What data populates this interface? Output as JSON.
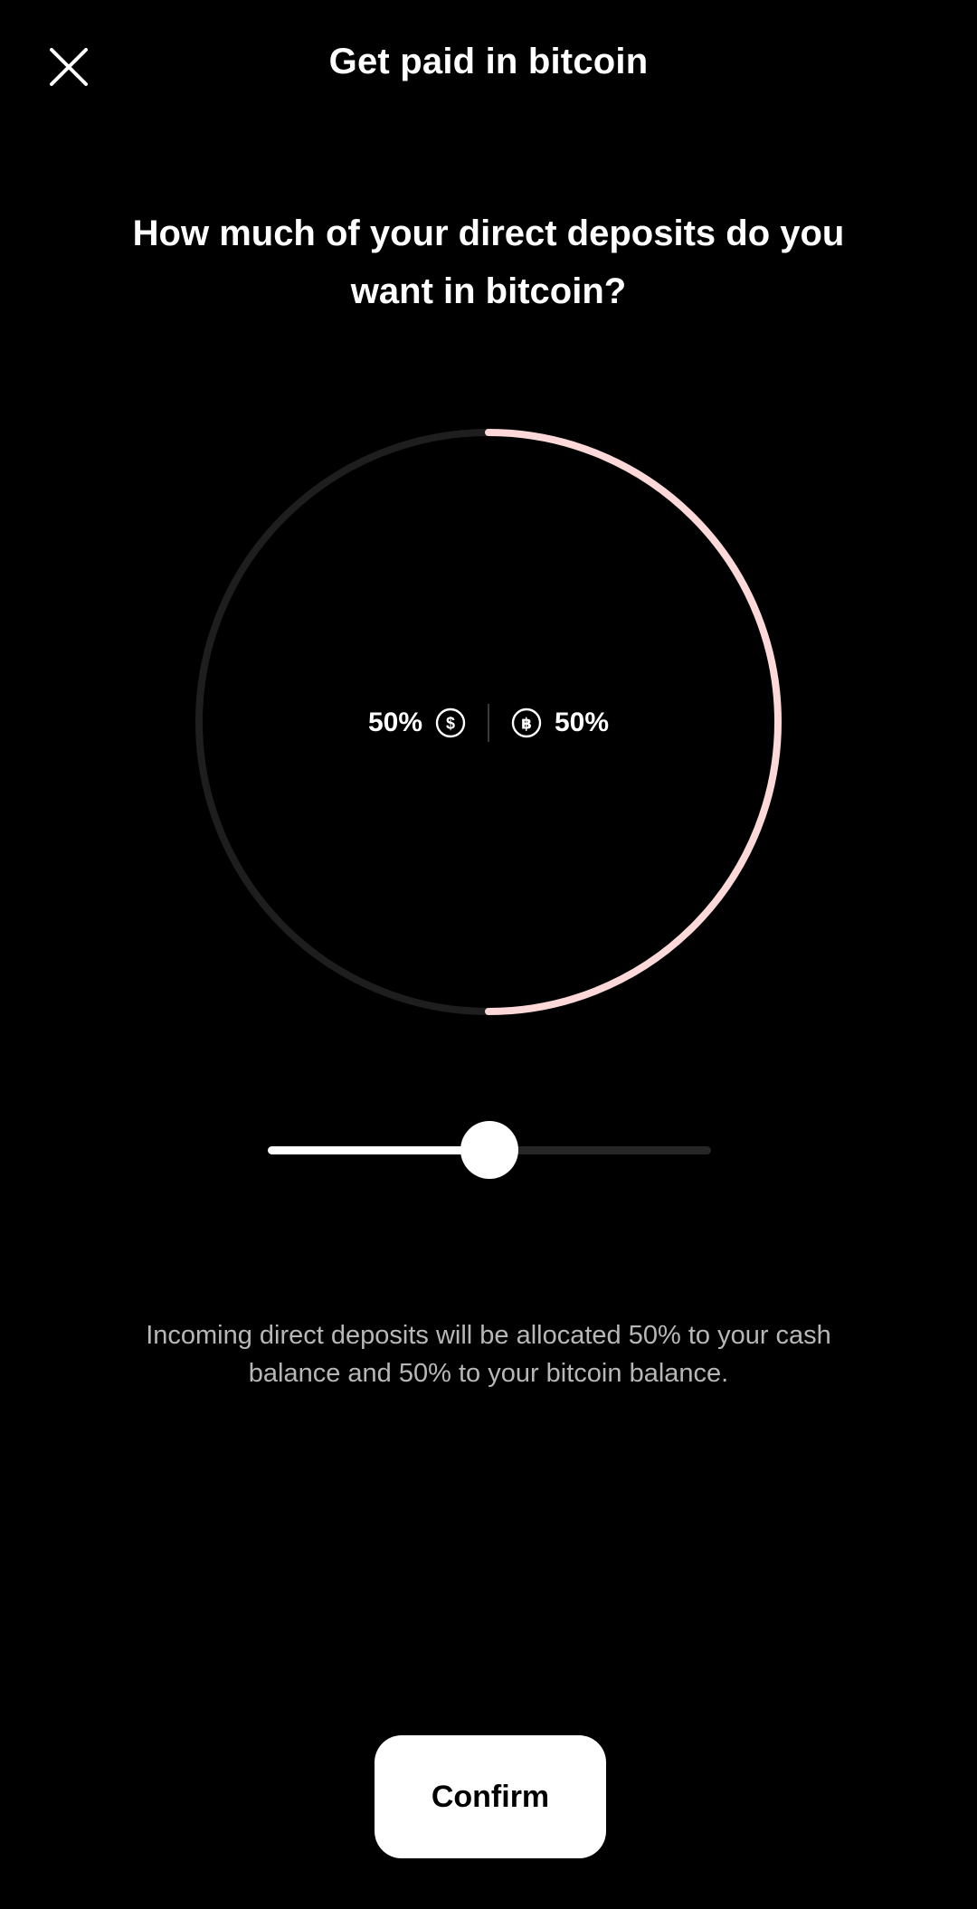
{
  "header": {
    "title": "Get paid in bitcoin",
    "close_icon": "close-icon"
  },
  "question": "How much of your direct deposits do you want in bitcoin?",
  "allocation": {
    "cash_label": "50%",
    "bitcoin_label": "50%",
    "bitcoin_fraction": 0.5,
    "cash_icon": "dollar-coin-icon",
    "bitcoin_icon": "bitcoin-coin-icon",
    "ring_track_color": "#1e1e1e",
    "ring_bitcoin_color": "#fcd8d8"
  },
  "slider": {
    "value_percent": 50
  },
  "description": "Incoming direct deposits will be allocated 50% to your cash balance and 50% to your bitcoin balance.",
  "confirm_label": "Confirm"
}
